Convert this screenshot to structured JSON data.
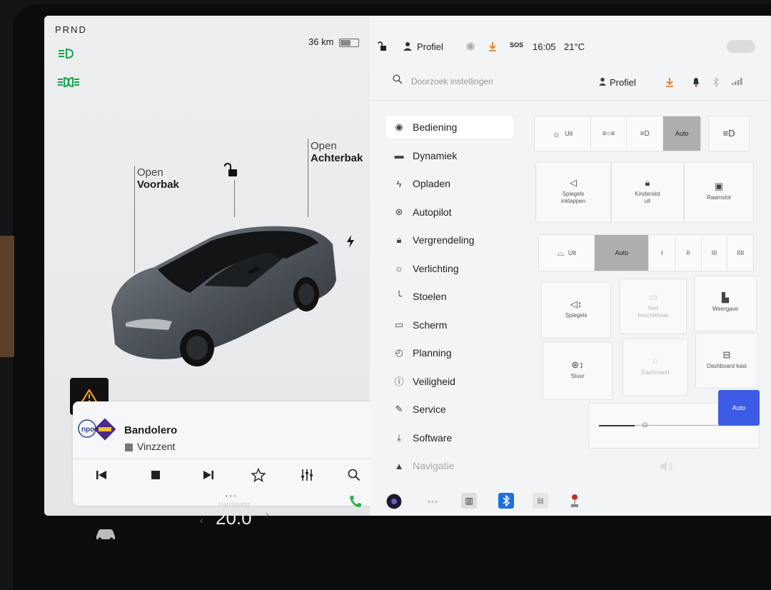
{
  "gear": "PRND",
  "range": "36 km",
  "battery_level": 0.6,
  "callouts": {
    "front": {
      "line1": "Open",
      "line2": "Voorbak"
    },
    "rear": {
      "line1": "Open",
      "line2": "Achterbak"
    }
  },
  "media": {
    "title": "Bandolero",
    "station": "Vinzzent",
    "logo_text": "npo"
  },
  "statusbar": {
    "profile": "Profiel",
    "sos": "SOS",
    "time": "16:05",
    "temperature": "21°C"
  },
  "search": {
    "placeholder": "Doorzoek instellingen"
  },
  "profile_right": "Profiel",
  "nav": [
    {
      "label": "Bediening",
      "icon": "toggle-icon",
      "active": true
    },
    {
      "label": "Dynamiek",
      "icon": "car-icon"
    },
    {
      "label": "Opladen",
      "icon": "bolt-icon"
    },
    {
      "label": "Autopilot",
      "icon": "steering-wheel-icon"
    },
    {
      "label": "Vergrendeling",
      "icon": "lock-icon"
    },
    {
      "label": "Verlichting",
      "icon": "sun-icon"
    },
    {
      "label": "Stoelen",
      "icon": "seat-icon"
    },
    {
      "label": "Scherm",
      "icon": "screen-icon"
    },
    {
      "label": "Planning",
      "icon": "alarm-clock-icon"
    },
    {
      "label": "Veiligheid",
      "icon": "info-circle-icon"
    },
    {
      "label": "Service",
      "icon": "wrench-icon"
    },
    {
      "label": "Software",
      "icon": "download-icon"
    },
    {
      "label": "Navigatie",
      "icon": "navigation-icon"
    }
  ],
  "lights": {
    "off": "Uit",
    "auto": "Auto"
  },
  "tiles_row1": [
    {
      "line1": "Spiegels",
      "line2": "inklappen"
    },
    {
      "line1": "Kinderslot",
      "line2": "uit"
    },
    {
      "line1": "Raamslot",
      "line2": ""
    }
  ],
  "wipers": {
    "off": "Uit",
    "auto": "Auto",
    "speeds": [
      "I",
      "II",
      "III",
      "IIII"
    ]
  },
  "tiles_grid": {
    "mirrors": "Spiegels",
    "not_available_1": "Niet",
    "not_available_2": "beschikbaar",
    "screen": "Weergave",
    "steering": "Stuur",
    "unavailable2": "Dashboard",
    "dashcam": "Dashboard kast"
  },
  "auto_button": "Auto",
  "climate": {
    "mode": "Handmatig",
    "temperature": "20.0"
  }
}
